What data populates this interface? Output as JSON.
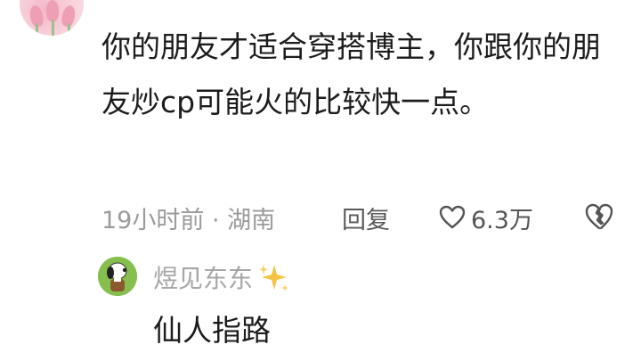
{
  "comment": {
    "username": "",
    "text": "你的朋友才适合穿搭博主，你跟你的朋友炒cp可能火的比较快一点。",
    "time_location": "19小时前 · 湖南",
    "reply_label": "回复",
    "like_count": "6.3万"
  },
  "reply": {
    "username": "煜见东东",
    "text": "仙人指路"
  },
  "icons": {
    "like": "heart-outline-icon",
    "dislike": "broken-heart-icon",
    "sparkle": "sparkles-icon"
  },
  "colors": {
    "text": "#1c1c1c",
    "meta": "#9b9b9b",
    "sparkle": "#f5c542"
  }
}
